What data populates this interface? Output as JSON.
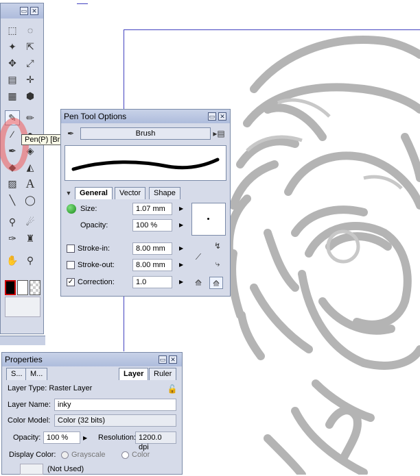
{
  "toolbox": {
    "minimize_label": "▭",
    "close_label": "✕"
  },
  "tooltip": "Pen(P) [Brush]",
  "pen_options": {
    "title": "Pen Tool Options",
    "brush_name": "Brush",
    "tabs": [
      "General",
      "Vector",
      "Shape"
    ],
    "size_label": "Size:",
    "size_value": "1.07 mm",
    "opacity_label": "Opacity:",
    "opacity_value": "100 %",
    "stroke_in_label": "Stroke-in:",
    "stroke_in_value": "8.00 mm",
    "stroke_out_label": "Stroke-out:",
    "stroke_out_value": "8.00 mm",
    "correction_label": "Correction:",
    "correction_value": "1.0"
  },
  "properties": {
    "title": "Properties",
    "tabs": [
      "S...",
      "M...",
      "Layer",
      "Ruler"
    ],
    "layer_type": "Layer Type: Raster Layer",
    "layer_name_label": "Layer Name:",
    "layer_name_value": "inky",
    "color_model_label": "Color Model:",
    "color_model_value": "Color (32 bits)",
    "opacity_label": "Opacity:",
    "opacity_value": "100 %",
    "resolution_label": "Resolution:",
    "resolution_value": "1200.0 dpi",
    "display_color_label": "Display Color:",
    "grayscale_label": "Grayscale",
    "color_label": "Color",
    "not_used_label": "(Not Used)"
  },
  "colors": {
    "panel_bg": "#d6dbe9",
    "title_bar": "#aebcdc",
    "sketch_gray": "#b4b4b4",
    "frame_blue": "#4040c0"
  }
}
